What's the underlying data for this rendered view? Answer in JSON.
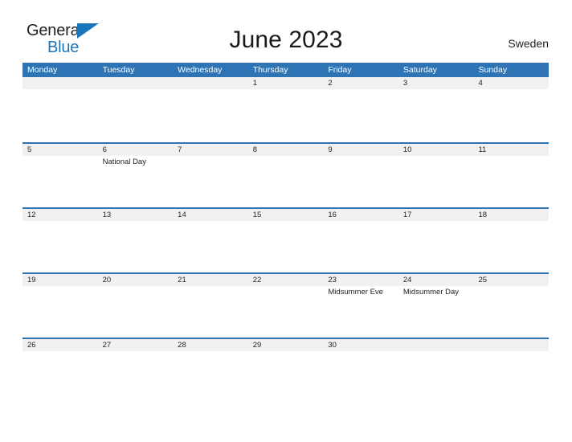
{
  "brand": {
    "name_part1": "General",
    "name_part2": "Blue",
    "triangle_icon": "blue-triangle-icon",
    "accent_color": "#1b75bb"
  },
  "header": {
    "title": "June 2023",
    "locale": "Sweden"
  },
  "theme": {
    "header_blue": "#2e74b5",
    "daynum_strip_gray": "#f1f1f1",
    "text_color": "#231f20"
  },
  "calendar": {
    "weekdays": [
      "Monday",
      "Tuesday",
      "Wednesday",
      "Thursday",
      "Friday",
      "Saturday",
      "Sunday"
    ],
    "weeks": [
      {
        "days": [
          {
            "num": "",
            "event": ""
          },
          {
            "num": "",
            "event": ""
          },
          {
            "num": "",
            "event": ""
          },
          {
            "num": "1",
            "event": ""
          },
          {
            "num": "2",
            "event": ""
          },
          {
            "num": "3",
            "event": ""
          },
          {
            "num": "4",
            "event": ""
          }
        ]
      },
      {
        "days": [
          {
            "num": "5",
            "event": ""
          },
          {
            "num": "6",
            "event": "National Day"
          },
          {
            "num": "7",
            "event": ""
          },
          {
            "num": "8",
            "event": ""
          },
          {
            "num": "9",
            "event": ""
          },
          {
            "num": "10",
            "event": ""
          },
          {
            "num": "11",
            "event": ""
          }
        ]
      },
      {
        "days": [
          {
            "num": "12",
            "event": ""
          },
          {
            "num": "13",
            "event": ""
          },
          {
            "num": "14",
            "event": ""
          },
          {
            "num": "15",
            "event": ""
          },
          {
            "num": "16",
            "event": ""
          },
          {
            "num": "17",
            "event": ""
          },
          {
            "num": "18",
            "event": ""
          }
        ]
      },
      {
        "days": [
          {
            "num": "19",
            "event": ""
          },
          {
            "num": "20",
            "event": ""
          },
          {
            "num": "21",
            "event": ""
          },
          {
            "num": "22",
            "event": ""
          },
          {
            "num": "23",
            "event": "Midsummer Eve"
          },
          {
            "num": "24",
            "event": "Midsummer Day"
          },
          {
            "num": "25",
            "event": ""
          }
        ]
      },
      {
        "days": [
          {
            "num": "26",
            "event": ""
          },
          {
            "num": "27",
            "event": ""
          },
          {
            "num": "28",
            "event": ""
          },
          {
            "num": "29",
            "event": ""
          },
          {
            "num": "30",
            "event": ""
          },
          {
            "num": "",
            "event": ""
          },
          {
            "num": "",
            "event": ""
          }
        ]
      }
    ]
  }
}
